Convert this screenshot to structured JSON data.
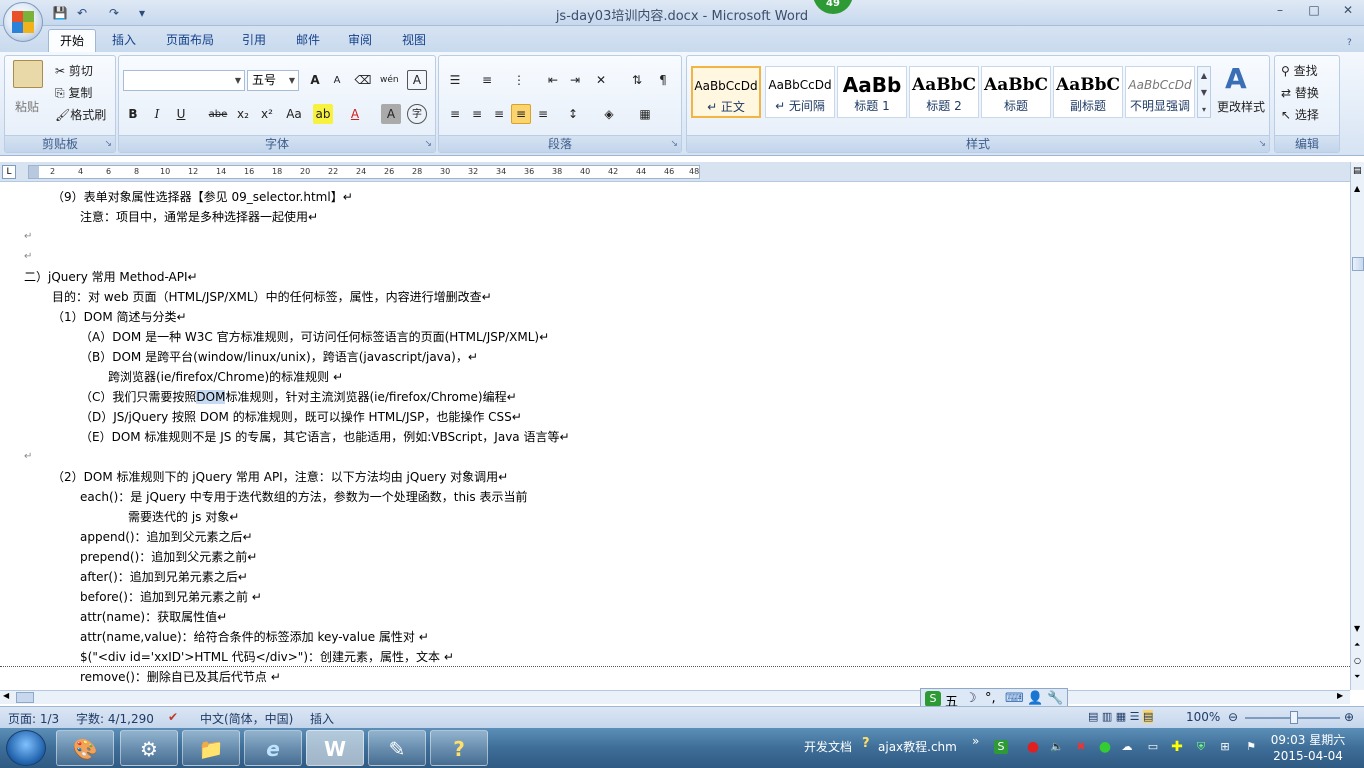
{
  "window": {
    "title": "js-day03培训内容.docx - Microsoft Word",
    "badge": "49",
    "controls": [
      "–",
      "□",
      "✕"
    ]
  },
  "quick_access": {
    "save": "💾",
    "undo": "↶",
    "redo": "↷",
    "customize": "▾"
  },
  "tabs": [
    "开始",
    "插入",
    "页面布局",
    "引用",
    "邮件",
    "审阅",
    "视图"
  ],
  "ribbon": {
    "clipboard": {
      "label": "剪贴板",
      "paste": "粘贴",
      "cut": "剪切",
      "copy": "复制",
      "format_painter": "格式刷"
    },
    "font": {
      "label": "字体",
      "font_name": "",
      "font_size": "五号",
      "bold": "B",
      "italic": "I",
      "underline": "U",
      "strike": "abe",
      "subscript": "x₂",
      "superscript": "x²",
      "change_case": "Aa",
      "grow": "A",
      "shrink": "A",
      "pinyin": "wén",
      "char_border": "A",
      "char_shading": "A",
      "enclose": "字"
    },
    "paragraph": {
      "label": "段落"
    },
    "styles": {
      "label": "样式",
      "items": [
        {
          "sample": "AaBbCcDd",
          "name": "↵ 正文",
          "selected": true
        },
        {
          "sample": "AaBbCcDd",
          "name": "↵ 无间隔"
        },
        {
          "sample": "AaBb",
          "name": "标题 1"
        },
        {
          "sample": "AaBbC",
          "name": "标题 2"
        },
        {
          "sample": "AaBbC",
          "name": "标题"
        },
        {
          "sample": "AaBbC",
          "name": "副标题"
        },
        {
          "sample": "AaBbCcDd",
          "name": "不明显强调"
        }
      ],
      "change_styles": "更改样式"
    },
    "editing": {
      "label": "编辑",
      "find": "查找",
      "replace": "替换",
      "select": "选择"
    }
  },
  "ruler": {
    "ticks": [
      "2",
      "4",
      "6",
      "8",
      "10",
      "12",
      "14",
      "16",
      "18",
      "20",
      "22",
      "24",
      "26",
      "28",
      "30",
      "32",
      "34",
      "36",
      "38",
      "40",
      "42",
      "44",
      "46",
      "48"
    ]
  },
  "document": {
    "lines": [
      "（9）表单对象属性选择器【参见 09_selector.html】↵",
      "注意：项目中，通常是多种选择器一起使用↵",
      "↵",
      "↵",
      "二）jQuery 常用 Method-API↵",
      "目的：对 web 页面（HTML/JSP/XML）中的任何标签，属性，内容进行增删改查↵",
      "（1）DOM 简述与分类↵",
      "（A）DOM 是一种 W3C 官方标准规则，可访问任何标签语言的页面(HTML/JSP/XML)↵",
      "（B）DOM 是跨平台(window/linux/unix)，跨语言(javascript/java)，↵",
      "跨浏览器(ie/firefox/Chrome)的标准规则 ↵",
      "（C）我们只需要按照",
      "DOM",
      "标准规则，针对主流浏览器(ie/firefox/Chrome)编程↵",
      "（D）JS/jQuery 按照 DOM 的标准规则，既可以操作 HTML/JSP，也能操作 CSS↵",
      "（E）DOM 标准规则不是 JS 的专属，其它语言，也能适用，例如:VBScript，Java 语言等↵",
      "↵",
      "（2）DOM 标准规则下的 jQuery 常用 API，注意：以下方法均由 jQuery 对象调用↵",
      "each()：是 jQuery 中专用于迭代数组的方法，参数为一个处理函数，this 表示当前",
      "需要迭代的 js 对象↵",
      "append()：追加到父元素之后↵",
      "prepend()：追加到父元素之前↵",
      "after()：追加到兄弟元素之后↵",
      "before()：追加到兄弟元素之前 ↵",
      "attr(name)：获取属性值↵",
      "attr(name,value)：给符合条件的标签添加 key-value 属性对 ↵",
      "$(\"<div id='xxID'>HTML 代码</div>\")：创建元素，属性，文本 ↵",
      "remove()：删除自已及其后代节点 ↵"
    ]
  },
  "ime": {
    "items": [
      "S",
      "五",
      "☽",
      "°,",
      "⌨",
      "👤",
      "🔧"
    ]
  },
  "status": {
    "page": "页面: 1/3",
    "words": "字数: 4/1,290",
    "language": "中文(简体，中国)",
    "mode": "插入",
    "zoom": "100%",
    "zoom_level_percent": 100
  },
  "taskbar": {
    "apps": [
      "🎨",
      "⚙",
      "📁",
      "e",
      "W",
      "✎",
      "?"
    ],
    "tray_text": "开发文档",
    "tray_app": "ajax教程.chm",
    "tray_expand": "»",
    "clock_time": "09:03 星期六",
    "clock_date": "2015-04-04"
  }
}
